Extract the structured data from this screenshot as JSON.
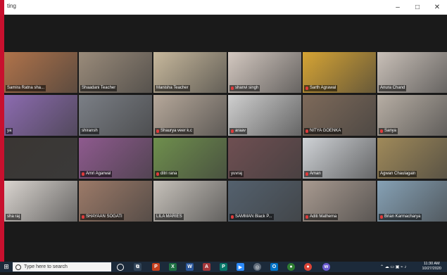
{
  "window": {
    "title": "ting",
    "minimize": "–",
    "maximize": "□",
    "close": "✕"
  },
  "participants": [
    {
      "name": "Samira Ratna sha...",
      "muted": false,
      "color": "#b0734a"
    },
    {
      "name": "Shaadani Teacher",
      "muted": false,
      "color": "#9a8b7a"
    },
    {
      "name": "Manisha Teacher",
      "muted": false,
      "color": "#c7b89c",
      "active": true
    },
    {
      "name": "shanvi singh",
      "muted": true,
      "color": "#d3c8c0"
    },
    {
      "name": "Sarth Agrawal",
      "muted": true,
      "color": "#d6a434"
    },
    {
      "name": "Anura Chand",
      "muted": false,
      "color": "#c9c0b8"
    },
    {
      "name": "ya",
      "muted": false,
      "color": "#8c6bb0"
    },
    {
      "name": "shiransh",
      "muted": false,
      "color": "#7b7f86"
    },
    {
      "name": "Shaurya veer k.c",
      "muted": true,
      "color": "#b6a89a"
    },
    {
      "name": "araav",
      "muted": true,
      "color": "#cfcfcf"
    },
    {
      "name": "NITYA GOENKA",
      "muted": true,
      "color": "#7e6a5a"
    },
    {
      "name": "Sanya",
      "muted": true,
      "color": "#b7aea4"
    },
    {
      "name": "",
      "muted": false,
      "color": "#3a3633"
    },
    {
      "name": "Amri Agarwal",
      "muted": true,
      "color": "#8e5a8e"
    },
    {
      "name": "ditri rana",
      "muted": true,
      "color": "#6f8f4d"
    },
    {
      "name": "yuvraj",
      "muted": false,
      "color": "#6f4f52"
    },
    {
      "name": "Aman",
      "muted": true,
      "color": "#cfd2d6"
    },
    {
      "name": "Agwan Chaulagain",
      "muted": false,
      "color": "#a08a5a"
    },
    {
      "name": "sha raj",
      "muted": false,
      "color": "#d9d4cf"
    },
    {
      "name": "SHAYAAN SOGATI",
      "muted": true,
      "color": "#9c7a68"
    },
    {
      "name": "LILA MARIES",
      "muted": false,
      "color": "#c6c1ba"
    },
    {
      "name": "SAMMAN Black P...",
      "muted": true,
      "color": "#54616e"
    },
    {
      "name": "Aditi Mathema",
      "muted": true,
      "color": "#a89a90"
    },
    {
      "name": "Brian Karmacharya",
      "muted": true,
      "color": "#86a1b5"
    }
  ],
  "taskbar": {
    "search_placeholder": "Type here to search",
    "time": "11:30 AM",
    "date": "10/27/2020",
    "apps": [
      "task-view",
      "powerpoint",
      "excel",
      "word",
      "access",
      "publisher",
      "zoom",
      "chrome-alt",
      "outlook",
      "chrome",
      "edge",
      "unknown"
    ]
  },
  "colors": {
    "accent": "#b6d72c",
    "taskbar": "#1c2a3a",
    "red_edge": "#c8102e"
  }
}
